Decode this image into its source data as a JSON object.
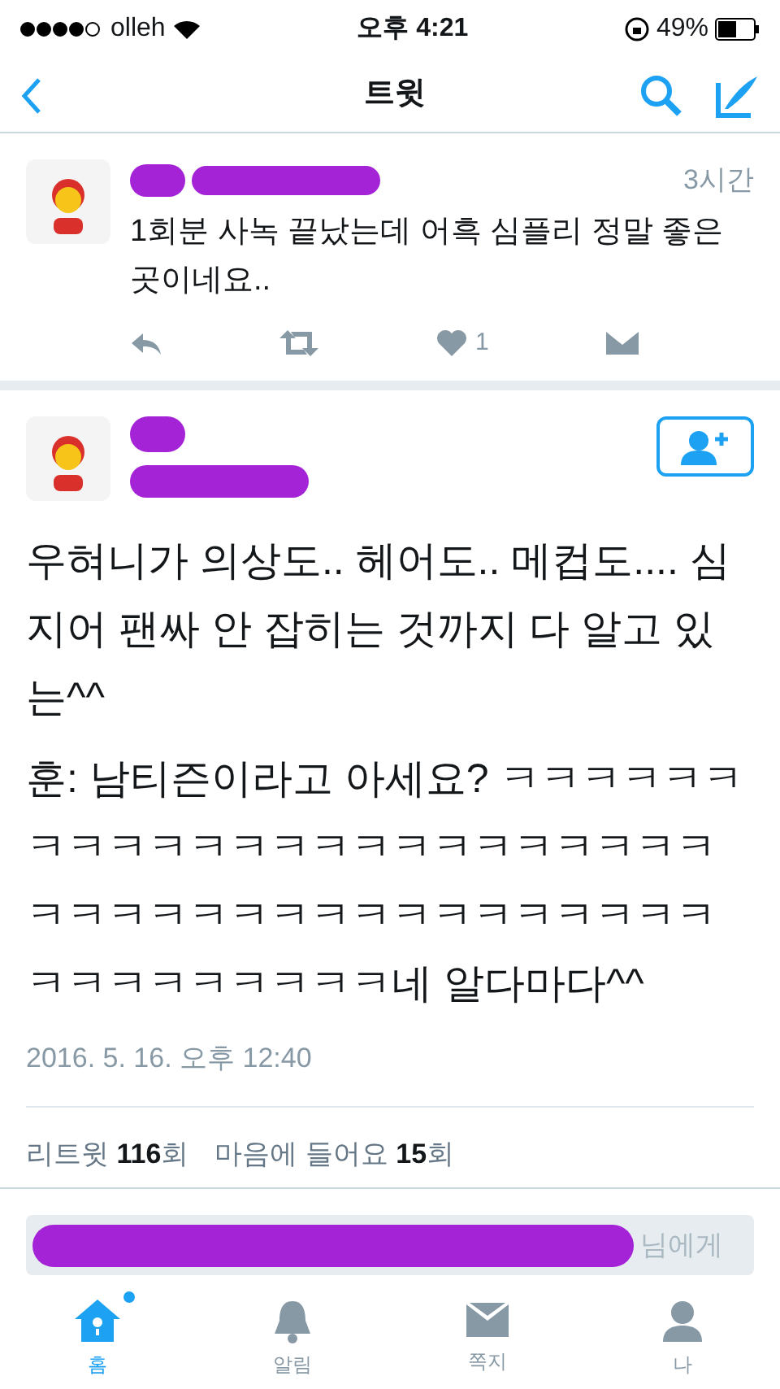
{
  "status_bar": {
    "carrier": "olleh",
    "time": "오후 4:21",
    "battery": "49%"
  },
  "nav": {
    "title": "트윗"
  },
  "reply_tweet": {
    "time": "3시간",
    "text": "1회분 사녹 끝났는데 어흑 심플리 정말 좋은 곳이네요..",
    "like_count": "1"
  },
  "tweet": {
    "paragraphs": [
      "우혀니가 의상도.. 헤어도.. 메컵도.... 심지어 팬싸 안 잡히는 것까지 다 알고 있는^^",
      "훈: 남티즌이라고 아세요? ㅋㅋㅋㅋㅋㅋㅋㅋㅋㅋㅋㅋㅋㅋㅋㅋㅋㅋㅋㅋㅋㅋㅋㅋㅋㅋㅋㅋㅋㅋㅋㅋㅋㅋㅋㅋㅋㅋㅋㅋㅋㅋㅋㅋㅋㅋㅋㅋㅋ네 알다마다^^"
    ],
    "date": "2016. 5. 16. 오후 12:40",
    "stats": [
      {
        "label": "리트윗",
        "count": "116",
        "unit": "회"
      },
      {
        "label": "마음에 들어요",
        "count": "15",
        "unit": "회"
      }
    ]
  },
  "reply_field": {
    "placeholder": "님에게"
  },
  "tabs": [
    {
      "label": "홈",
      "selected": true,
      "kind": "home",
      "badge": true
    },
    {
      "label": "알림",
      "selected": false,
      "kind": "bell",
      "badge": false
    },
    {
      "label": "쪽지",
      "selected": false,
      "kind": "mail",
      "badge": false
    },
    {
      "label": "나",
      "selected": false,
      "kind": "person",
      "badge": false
    }
  ]
}
